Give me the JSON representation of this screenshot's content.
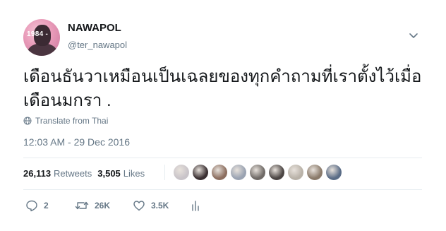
{
  "user": {
    "name": "NAWAPOL",
    "handle": "@ter_nawapol",
    "avatar_text": "1984 -"
  },
  "tweet": {
    "text": "เดือนธันวาเหมือนเป็นเฉลยของทุกคำถามที่เราตั้งไว้เมื่อเดือนมกรา .",
    "translate_label": "Translate from Thai",
    "timestamp": "12:03 AM - 29 Dec 2016"
  },
  "stats": {
    "retweets_count": "26,113",
    "retweets_label": "Retweets",
    "likes_count": "3,505",
    "likes_label": "Likes"
  },
  "likers": [
    {
      "color": "#c9c4c9"
    },
    {
      "color": "#3a3032"
    },
    {
      "color": "#8c6e5f"
    },
    {
      "color": "#9aa3b2"
    },
    {
      "color": "#6f6a66"
    },
    {
      "color": "#4b4543"
    },
    {
      "color": "#b9b2a8"
    },
    {
      "color": "#8a7a6a"
    },
    {
      "color": "#5a6c86"
    }
  ],
  "actions": {
    "reply_count": "2",
    "retweet_count": "26K",
    "like_count": "3.5K"
  },
  "colors": {
    "text_primary": "#14171a",
    "text_secondary": "#657786",
    "divider": "#e6ecf0"
  },
  "icons": {
    "caret": "chevron-down-icon",
    "globe": "globe-icon",
    "reply": "reply-icon",
    "retweet": "retweet-icon",
    "like": "heart-icon",
    "analytics": "analytics-icon"
  }
}
